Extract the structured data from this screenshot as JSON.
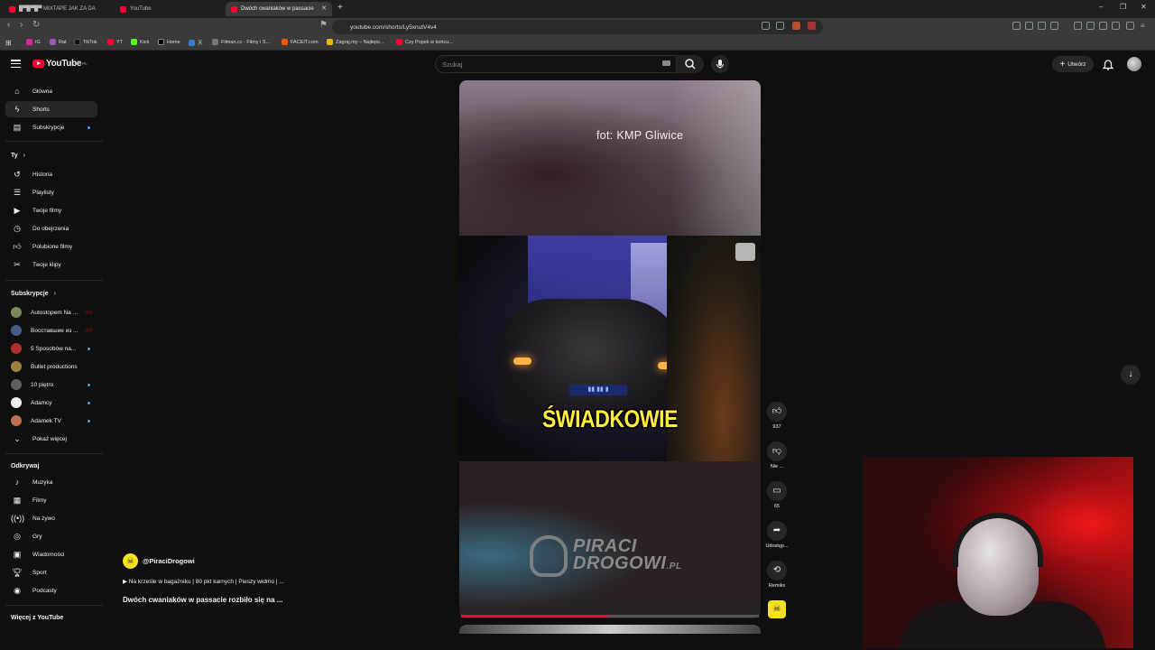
{
  "browser": {
    "tabs": [
      {
        "title": "█▀█▀█▀ MIXTAPE JAK ZA DA"
      },
      {
        "title": "YouTube"
      },
      {
        "title": "Dwóch cwaniaków w passacie"
      }
    ],
    "url": "youtube.com/shorts/Ly5xnutV4v4",
    "bookmarks": [
      "IG",
      "Rat",
      "TikTok",
      "YT",
      "Kick",
      "Home",
      "天",
      "Filman.cc - Filmy i S...",
      "FACEIT.com",
      "Zagraj.my – Najleps...",
      "Czy Popek w końcu..."
    ]
  },
  "header": {
    "logo": "YouTube",
    "logo_region": "PL",
    "search_placeholder": "Szukaj",
    "create_label": "Utwórz"
  },
  "sidebar": {
    "main": [
      {
        "label": "Główna",
        "icon": "home-icon"
      },
      {
        "label": "Shorts",
        "icon": "shorts-icon"
      },
      {
        "label": "Subskrypcje",
        "icon": "subscriptions-icon"
      }
    ],
    "you_title": "Ty",
    "you": [
      {
        "label": "Historia",
        "icon": "history-icon"
      },
      {
        "label": "Playlisty",
        "icon": "playlists-icon"
      },
      {
        "label": "Twoje filmy",
        "icon": "your-videos-icon"
      },
      {
        "label": "Do obejrzenia",
        "icon": "watch-later-icon"
      },
      {
        "label": "Polubione filmy",
        "icon": "liked-icon"
      },
      {
        "label": "Twoje klipy",
        "icon": "clips-icon"
      }
    ],
    "subs_title": "Subskrypcje",
    "subs": [
      {
        "label": "Autostopem Na ...",
        "color": "#7a8a5a"
      },
      {
        "label": "Восставшие из ...",
        "color": "#4a5a8a"
      },
      {
        "label": "5 Sposobów na...",
        "color": "#b03030"
      },
      {
        "label": "Bullet productions",
        "color": "#a08040"
      },
      {
        "label": "10 piętro",
        "color": "#606060"
      },
      {
        "label": "Adamcy",
        "color": "#eeeeee"
      },
      {
        "label": "Adamek TV",
        "color": "#c07050"
      }
    ],
    "show_more": "Pokaż więcej",
    "explore_title": "Odkrywaj",
    "explore": [
      {
        "label": "Muzyka",
        "icon": "music-icon"
      },
      {
        "label": "Filmy",
        "icon": "movies-icon"
      },
      {
        "label": "Na żywo",
        "icon": "live-icon"
      },
      {
        "label": "Gry",
        "icon": "gaming-icon"
      },
      {
        "label": "Wiadomości",
        "icon": "news-icon"
      },
      {
        "label": "Sport",
        "icon": "sport-icon"
      },
      {
        "label": "Podcasty",
        "icon": "podcasts-icon"
      }
    ],
    "more_title": "Więcej z YouTube"
  },
  "short": {
    "caption_top": "fot: KMP Gliwice",
    "caption_mid": "ŚWIADKOWIE",
    "watermark_main": "PIRACI",
    "watermark_sub": "DROGOWI",
    "watermark_tld": ".PL",
    "progress": 0.49
  },
  "channel": {
    "name": "@PiraciDrogowi",
    "music": "▶ Na krześle w bagażniku | 80 pkt karnych | Pieszy widmo | ...",
    "title": "Dwóch cwaniaków w passacie rozbiło się na ..."
  },
  "actions": {
    "like_count": "937",
    "dislike_label": "Nie ...",
    "comments_count": "65",
    "share_label": "Udostęp...",
    "remix_label": "Remiks"
  }
}
